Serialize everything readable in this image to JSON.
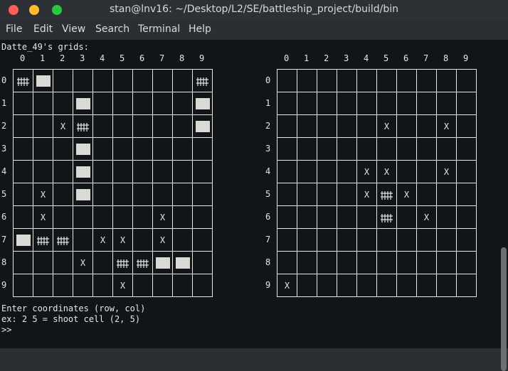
{
  "window": {
    "title": "stan@lnv16: ~/Desktop/L2/SE/battleship_project/build/bin"
  },
  "menu": [
    "File",
    "Edit",
    "View",
    "Search",
    "Terminal",
    "Help"
  ],
  "terminal": {
    "header": "Datte_49's grids:",
    "prompt_lines": [
      "Enter coordinates (row, col)",
      "ex: 2 5 = shoot cell (2, 5)",
      ">>"
    ]
  },
  "grids": {
    "col_labels": [
      "0",
      "1",
      "2",
      "3",
      "4",
      "5",
      "6",
      "7",
      "8",
      "9"
    ],
    "row_labels": [
      "0",
      "1",
      "2",
      "3",
      "4",
      "5",
      "6",
      "7",
      "8",
      "9"
    ],
    "left": {
      "ships": [
        [
          0,
          1
        ],
        [
          1,
          3
        ],
        [
          1,
          9
        ],
        [
          2,
          9
        ],
        [
          3,
          3
        ],
        [
          4,
          3
        ],
        [
          5,
          3
        ],
        [
          7,
          0
        ],
        [
          8,
          7
        ],
        [
          8,
          8
        ]
      ],
      "hits": [
        [
          0,
          0
        ],
        [
          0,
          9
        ],
        [
          2,
          3
        ],
        [
          7,
          1
        ],
        [
          7,
          2
        ],
        [
          8,
          5
        ],
        [
          8,
          6
        ]
      ],
      "misses": [
        [
          2,
          2
        ],
        [
          5,
          1
        ],
        [
          6,
          1
        ],
        [
          6,
          7
        ],
        [
          7,
          4
        ],
        [
          7,
          5
        ],
        [
          7,
          7
        ],
        [
          8,
          3
        ],
        [
          9,
          5
        ]
      ]
    },
    "right": {
      "ships": [],
      "hits": [
        [
          5,
          5
        ],
        [
          6,
          5
        ]
      ],
      "misses": [
        [
          2,
          5
        ],
        [
          2,
          8
        ],
        [
          4,
          4
        ],
        [
          4,
          5
        ],
        [
          4,
          8
        ],
        [
          5,
          4
        ],
        [
          5,
          6
        ],
        [
          6,
          7
        ],
        [
          9,
          0
        ]
      ]
    }
  }
}
